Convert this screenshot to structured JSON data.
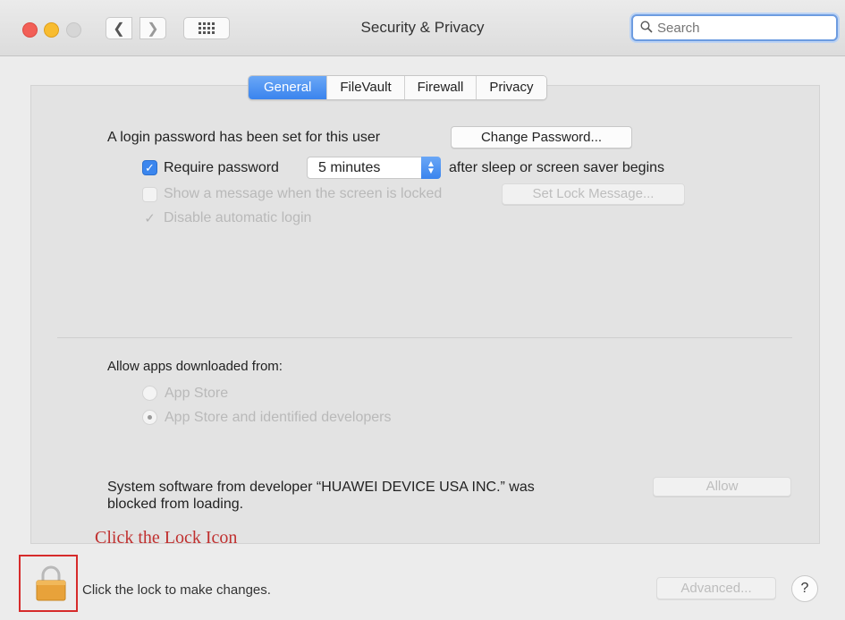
{
  "window": {
    "title": "Security & Privacy",
    "search_placeholder": "Search"
  },
  "tabs": [
    {
      "label": "General",
      "active": true
    },
    {
      "label": "FileVault",
      "active": false
    },
    {
      "label": "Firewall",
      "active": false
    },
    {
      "label": "Privacy",
      "active": false
    }
  ],
  "general": {
    "login_text": "A login password has been set for this user",
    "change_password_label": "Change Password...",
    "require_password_label": "Require password",
    "require_password_checked": true,
    "require_password_value": "5 minutes",
    "after_sleep_text": "after sleep or screen saver begins",
    "show_message_label": "Show a message when the screen is locked",
    "show_message_checked": false,
    "set_lock_message_label": "Set Lock Message...",
    "disable_auto_login_label": "Disable automatic login",
    "disable_auto_login_checked": true
  },
  "allow_apps": {
    "heading": "Allow apps downloaded from:",
    "options": [
      {
        "label": "App Store",
        "selected": false
      },
      {
        "label": "App Store and identified developers",
        "selected": true
      }
    ]
  },
  "blocked": {
    "line1": "System software from developer “HUAWEI DEVICE USA INC.” was",
    "line2": "blocked from loading.",
    "allow_label": "Allow"
  },
  "footer": {
    "annotation": "Click the Lock Icon",
    "lock_text": "Click the lock to make changes.",
    "advanced_label": "Advanced...",
    "help_label": "?"
  },
  "colors": {
    "accent": "#3b86ee",
    "annotation": "#c0302f",
    "lock_gold": "#e8a23a"
  },
  "icons": [
    "back-arrow-icon",
    "forward-arrow-icon",
    "grid-icon",
    "search-icon",
    "checkmark-icon",
    "lock-icon",
    "help-icon"
  ]
}
